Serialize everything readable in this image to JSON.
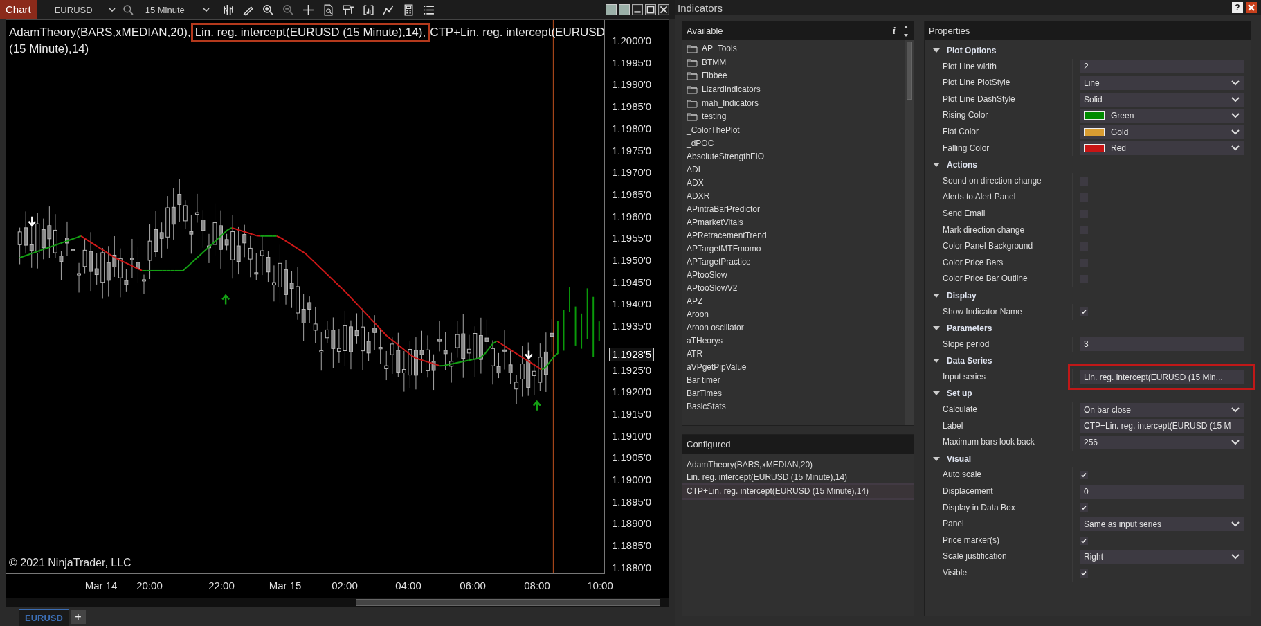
{
  "chart_window": {
    "title": "Chart",
    "instrument": "EURUSD",
    "interval": "15 Minute",
    "legend": [
      {
        "text": "AdamTheory(BARS,xMEDIAN,20),",
        "highlighted": false
      },
      {
        "text": "Lin. reg. intercept(EURUSD (15 Minute),14),",
        "highlighted": true
      },
      {
        "text": "CTP+Lin. reg. intercept(EURUSD (15 Minute),14)",
        "highlighted": false
      }
    ],
    "price_labels": [
      "1.2000'0",
      "1.1995'0",
      "1.1990'0",
      "1.1985'0",
      "1.1980'0",
      "1.1975'0",
      "1.1970'0",
      "1.1965'0",
      "1.1960'0",
      "1.1955'0",
      "1.1950'0",
      "1.1945'0",
      "1.1940'0",
      "1.1935'0",
      "1.1925'0",
      "1.1920'0",
      "1.1915'0",
      "1.1910'0",
      "1.1905'0",
      "1.1900'0",
      "1.1895'0",
      "1.1890'0",
      "1.1885'0",
      "1.1880'0"
    ],
    "current_price": "1.1928'5",
    "time_labels": [
      "Mar 14",
      "20:00",
      "22:00",
      "Mar 15",
      "02:00",
      "04:00",
      "06:00",
      "08:00",
      "10:00"
    ],
    "copyright": "© 2021 NinjaTrader, LLC",
    "tabs": [
      {
        "label": "EURUSD",
        "selected": true
      }
    ],
    "add_tab": "+"
  },
  "indicators_dialog": {
    "title": "Indicators",
    "help": "?",
    "available": {
      "title": "Available",
      "info": "i",
      "items": [
        {
          "kind": "folder",
          "label": "AP_Tools"
        },
        {
          "kind": "folder",
          "label": "BTMM"
        },
        {
          "kind": "folder",
          "label": "Fibbee"
        },
        {
          "kind": "folder",
          "label": "LizardIndicators"
        },
        {
          "kind": "folder",
          "label": "mah_Indicators"
        },
        {
          "kind": "folder",
          "label": "testing"
        },
        {
          "kind": "indicator",
          "label": "_ColorThePlot"
        },
        {
          "kind": "indicator",
          "label": "_dPOC"
        },
        {
          "kind": "indicator",
          "label": "AbsoluteStrengthFIO"
        },
        {
          "kind": "indicator",
          "label": "ADL"
        },
        {
          "kind": "indicator",
          "label": "ADX"
        },
        {
          "kind": "indicator",
          "label": "ADXR"
        },
        {
          "kind": "indicator",
          "label": "APintraBarPredictor"
        },
        {
          "kind": "indicator",
          "label": "APmarketVitals"
        },
        {
          "kind": "indicator",
          "label": "APRetracementTrend"
        },
        {
          "kind": "indicator",
          "label": "APTargetMTFmomo"
        },
        {
          "kind": "indicator",
          "label": "APTargetPractice"
        },
        {
          "kind": "indicator",
          "label": "APtooSlow"
        },
        {
          "kind": "indicator",
          "label": "APtooSlowV2"
        },
        {
          "kind": "indicator",
          "label": "APZ"
        },
        {
          "kind": "indicator",
          "label": "Aroon"
        },
        {
          "kind": "indicator",
          "label": "Aroon oscillator"
        },
        {
          "kind": "indicator",
          "label": "aTHeorys"
        },
        {
          "kind": "indicator",
          "label": "ATR"
        },
        {
          "kind": "indicator",
          "label": "aVPgetPipValue"
        },
        {
          "kind": "indicator",
          "label": "Bar timer"
        },
        {
          "kind": "indicator",
          "label": "BarTimes"
        },
        {
          "kind": "indicator",
          "label": "BasicStats"
        }
      ]
    },
    "configured": {
      "title": "Configured",
      "items": [
        {
          "label": "AdamTheory(BARS,xMEDIAN,20)",
          "selected": false
        },
        {
          "label": "Lin. reg. intercept(EURUSD (15 Minute),14)",
          "selected": false
        },
        {
          "label": "CTP+Lin. reg. intercept(EURUSD (15 Minute),14)",
          "selected": true
        }
      ]
    },
    "properties": {
      "title": "Properties",
      "sections": [
        {
          "title": "Plot Options",
          "expanded": true,
          "rows": [
            {
              "label": "Plot Line width",
              "kind": "text",
              "value": "2",
              "highlighted": false
            },
            {
              "label": "Plot Line PlotStyle",
              "kind": "select",
              "value": "Line",
              "highlighted": false
            },
            {
              "label": "Plot Line DashStyle",
              "kind": "select",
              "value": "Solid",
              "highlighted": false
            },
            {
              "label": "Rising Color",
              "kind": "color",
              "value": "Green",
              "color": "#008a00",
              "highlighted": false
            },
            {
              "label": "Flat Color",
              "kind": "color",
              "value": "Gold",
              "color": "#d89c32",
              "highlighted": false
            },
            {
              "label": "Falling Color",
              "kind": "color",
              "value": "Red",
              "color": "#c81414",
              "highlighted": false
            }
          ]
        },
        {
          "title": "Actions",
          "expanded": true,
          "rows": [
            {
              "label": "Sound on direction change",
              "kind": "checkbox",
              "checked": false,
              "highlighted": false
            },
            {
              "label": "Alerts to Alert Panel",
              "kind": "checkbox",
              "checked": false,
              "highlighted": false
            },
            {
              "label": "Send Email",
              "kind": "checkbox",
              "checked": false,
              "highlighted": false
            },
            {
              "label": "Mark direction change",
              "kind": "checkbox",
              "checked": false,
              "highlighted": false
            },
            {
              "label": "Color Panel Background",
              "kind": "checkbox",
              "checked": false,
              "highlighted": false
            },
            {
              "label": "Color Price Bars",
              "kind": "checkbox",
              "checked": false,
              "highlighted": false
            },
            {
              "label": "Color Price Bar Outline",
              "kind": "checkbox",
              "checked": false,
              "highlighted": false
            }
          ]
        },
        {
          "title": "Display",
          "expanded": true,
          "rows": [
            {
              "label": "Show Indicator Name",
              "kind": "checkbox",
              "checked": true,
              "highlighted": false
            }
          ]
        },
        {
          "title": "Parameters",
          "expanded": true,
          "rows": [
            {
              "label": "Slope period",
              "kind": "text",
              "value": "3",
              "highlighted": false
            }
          ]
        },
        {
          "title": "Data Series",
          "expanded": true,
          "rows": [
            {
              "label": "Input series",
              "kind": "text",
              "value": "Lin. reg. intercept(EURUSD (15 Min...",
              "highlighted": true
            }
          ]
        },
        {
          "title": "Set up",
          "expanded": true,
          "rows": [
            {
              "label": "Calculate",
              "kind": "select",
              "value": "On bar close",
              "highlighted": false
            },
            {
              "label": "Label",
              "kind": "text",
              "value": "CTP+Lin. reg. intercept(EURUSD (15 M",
              "highlighted": false
            },
            {
              "label": "Maximum bars look back",
              "kind": "select",
              "value": "256",
              "highlighted": false
            }
          ]
        },
        {
          "title": "Visual",
          "expanded": true,
          "rows": [
            {
              "label": "Auto scale",
              "kind": "checkbox",
              "checked": true,
              "highlighted": false
            },
            {
              "label": "Displacement",
              "kind": "text",
              "value": "0",
              "highlighted": false
            },
            {
              "label": "Display in Data Box",
              "kind": "checkbox",
              "checked": true,
              "highlighted": false
            },
            {
              "label": "Panel",
              "kind": "select",
              "value": "Same as input series",
              "highlighted": false
            },
            {
              "label": "Price marker(s)",
              "kind": "checkbox",
              "checked": true,
              "highlighted": false
            },
            {
              "label": "Scale justification",
              "kind": "select",
              "value": "Right",
              "highlighted": false
            },
            {
              "label": "Visible",
              "kind": "checkbox",
              "checked": true,
              "highlighted": false
            }
          ]
        }
      ]
    }
  }
}
